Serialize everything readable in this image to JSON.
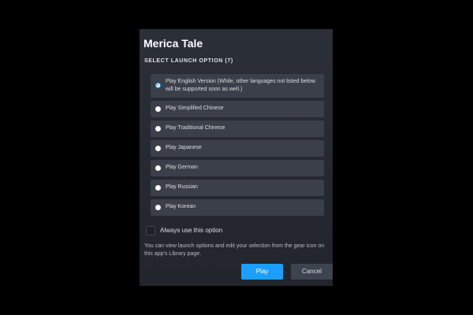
{
  "dialog": {
    "title": "Merica Tale",
    "section_label": "SELECT LAUNCH OPTION (7)",
    "options": [
      {
        "label": "Play English Version (While, other languages not listed below will be supported soon as well.)",
        "selected": true
      },
      {
        "label": "Play Simplified Chinese",
        "selected": false
      },
      {
        "label": "Play Traditional Chinese",
        "selected": false
      },
      {
        "label": "Play Japanese",
        "selected": false
      },
      {
        "label": "Play German",
        "selected": false
      },
      {
        "label": "Play Russian",
        "selected": false
      },
      {
        "label": "Play Korean",
        "selected": false
      }
    ],
    "always_use_label": "Always use this option",
    "always_use_checked": false,
    "help_text": "You can view launch options and edit your selection from the gear icon on this app's Library page.",
    "play_label": "Play",
    "cancel_label": "Cancel"
  },
  "colors": {
    "accent": "#1a9fff",
    "background": "#000000",
    "dialog_bg": "#2b2f38",
    "option_bg": "#3a3f4a"
  }
}
